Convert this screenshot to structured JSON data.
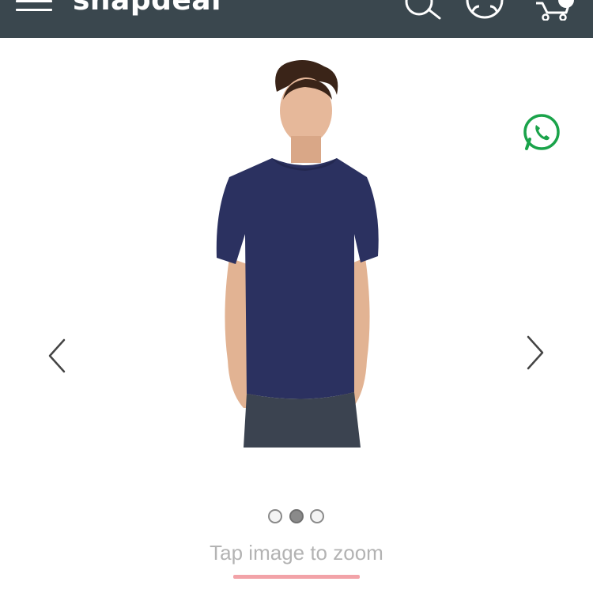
{
  "header": {
    "logo_text": "snapdeal",
    "icons": [
      "menu-icon",
      "search-icon",
      "account-icon",
      "cart-icon"
    ],
    "background_color": "#3a474e"
  },
  "product": {
    "image": "navy-round-neck-tshirt-model",
    "shirt_color": "#2b3160",
    "active_image_index": 1,
    "image_count": 3
  },
  "share": {
    "icon": "whatsapp-icon",
    "color": "#1aa34a"
  },
  "nav": {
    "prev_icon": "chevron-left-icon",
    "next_icon": "chevron-right-icon"
  },
  "zoom_hint": "Tap image to zoom",
  "accent_color": "#f2a3a8"
}
